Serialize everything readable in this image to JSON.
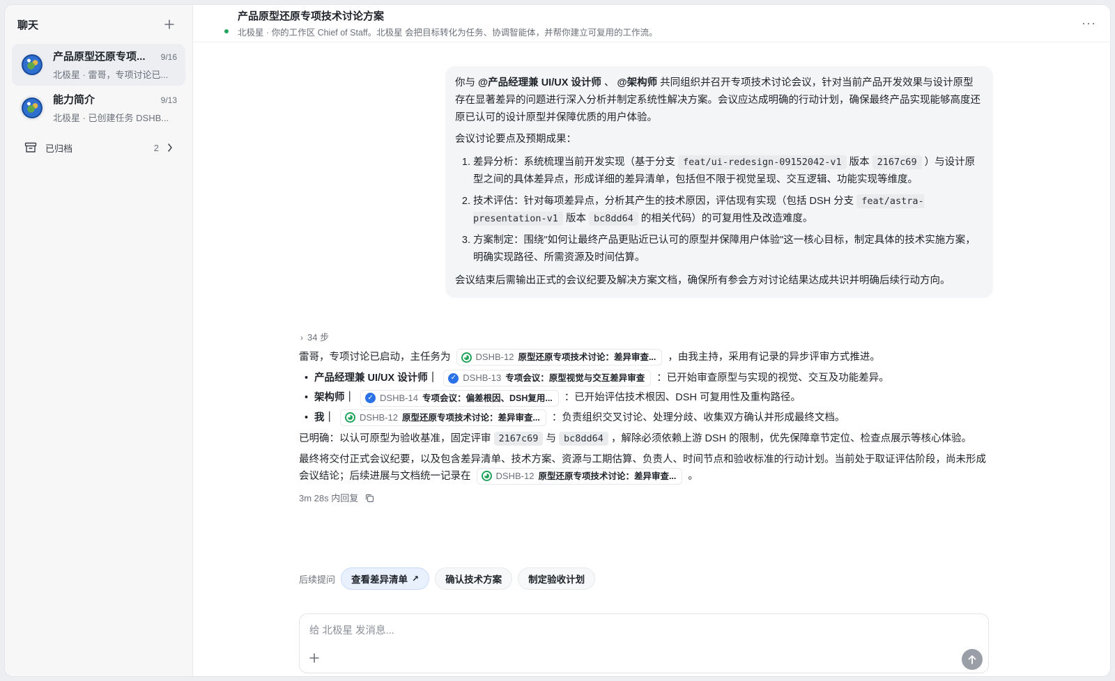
{
  "sidebar": {
    "title": "聊天",
    "new_chat_icon": "plus-icon",
    "chats": [
      {
        "name": "产品原型还原专项...",
        "date": "9/16",
        "preview": "北极星 · 雷哥，专项讨论已...",
        "active": true
      },
      {
        "name": "能力简介",
        "date": "9/13",
        "preview": "北极星 · 已创建任务 DSHB...",
        "active": false
      }
    ],
    "archived": {
      "label": "已归档",
      "count": "2"
    }
  },
  "header": {
    "title": "产品原型还原专项技术讨论方案",
    "subtitle": "北极星 · 你的工作区 Chief of Staff。北极星 会把目标转化为任务、协调智能体，并帮你建立可复用的工作流。",
    "more": "···"
  },
  "user_message": {
    "p1_pre": "你与",
    "mention1": "@产品经理兼 UI/UX 设计师",
    "sep": "、",
    "mention2": "@架构师",
    "p1_post": "共同组织并召开专项技术讨论会议，针对当前产品开发效果与设计原型存在显著差异的问题进行深入分析并制定系统性解决方案。会议应达成明确的行动计划，确保最终产品实现能够高度还原已认可的设计原型并保障优质的用户体验。",
    "p2": "会议讨论要点及预期成果：",
    "item1_pre": "差异分析：系统梳理当前开发实现（基于分支",
    "item1_code1": "feat/ui-redesign-09152042-v1",
    "item1_mid": "版本",
    "item1_code2": "2167c69",
    "item1_post": "）与设计原型之间的具体差异点，形成详细的差异清单，包括但不限于视觉呈现、交互逻辑、功能实现等维度。",
    "item2_pre": "技术评估：针对每项差异点，分析其产生的技术原因，评估现有实现（包括 DSH 分支",
    "item2_code1": "feat/astra-presentation-v1",
    "item2_mid": "版本",
    "item2_code2": "bc8dd64",
    "item2_post": "的相关代码）的可复用性及改造难度。",
    "item3": "方案制定：围绕\"如何让最终产品更贴近已认可的原型并保障用户体验\"这一核心目标，制定具体的技术实施方案，明确实现路径、所需资源及时间估算。",
    "p3": "会议结束后需输出正式的会议纪要及解决方案文档，确保所有参会方对讨论结果达成共识并明确后续行动方向。"
  },
  "assistant": {
    "steps": "34 步",
    "intro_pre": "雷哥，专项讨论已启动，主任务为",
    "intro_post": "，由我主持，采用有记录的异步评审方式推进。",
    "main_task": {
      "id": "DSHB-12",
      "title": "原型还原专项技术讨论：差异审查...",
      "status": "in-progress"
    },
    "assignments": [
      {
        "who": "产品经理兼 UI/UX 设计师",
        "sep": "｜",
        "id": "DSHB-13",
        "title": "专项会议：原型视觉与交互差异审查",
        "status": "done",
        "desc": "：已开始审查原型与实现的视觉、交互及功能差异。"
      },
      {
        "who": "架构师",
        "sep": "｜",
        "id": "DSHB-14",
        "title": "专项会议：偏差根因、DSH复用...",
        "status": "done",
        "desc": "：已开始评估技术根因、DSH 可复用性及重构路径。"
      },
      {
        "who": "我",
        "sep": "｜",
        "id": "DSHB-12",
        "title": "原型还原专项技术讨论：差异审查...",
        "status": "in-progress",
        "desc": "：负责组织交叉讨论、处理分歧、收集双方确认并形成最终文档。"
      }
    ],
    "clarify_pre": "已明确：以认可原型为验收基准，固定评审",
    "clarify_code1": "2167c69",
    "clarify_mid": "与",
    "clarify_code2": "bc8dd64",
    "clarify_post": "，解除必须依赖上游 DSH 的限制，优先保障章节定位、检查点展示等核心体验。",
    "final_pre": "最终将交付正式会议纪要，以及包含差异清单、技术方案、资源与工期估算、负责人、时间节点和验收标准的行动计划。当前处于取证评估阶段，尚未形成会议结论；后续进展与文档统一记录在",
    "final_post": "。",
    "meta": "3m 28s 内回复"
  },
  "followups": {
    "label": "后续提问",
    "buttons": [
      "查看差异清单",
      "确认技术方案",
      "制定验收计划"
    ]
  },
  "composer": {
    "placeholder": "给 北极星 发消息...",
    "value": ""
  },
  "colors": {
    "accent_blue": "#2a72e5",
    "status_green": "#22a35a",
    "chip_primary_bg": "#eaf1fe"
  }
}
